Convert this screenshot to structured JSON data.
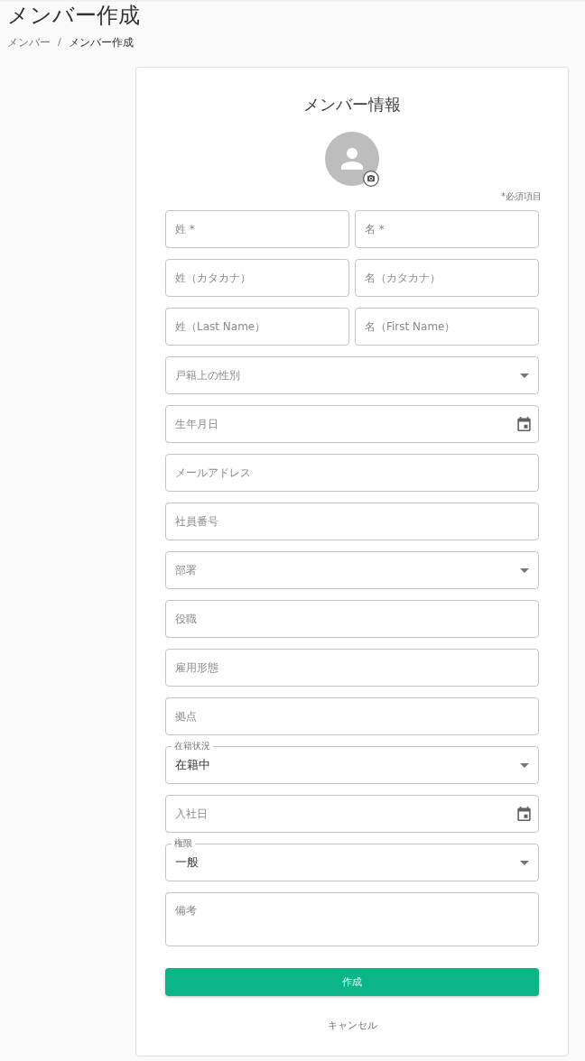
{
  "page": {
    "title": "メンバー作成",
    "breadcrumb": [
      {
        "label": "メンバー",
        "current": false
      },
      {
        "label": "メンバー作成",
        "current": true
      }
    ],
    "breadcrumb_separator": "/"
  },
  "card": {
    "title": "メンバー情報",
    "required_note": "*必須項目",
    "rows": [
      {
        "fields": [
          {
            "kind": "text",
            "label": "姓 *"
          },
          {
            "kind": "text",
            "label": "名 *"
          }
        ]
      },
      {
        "fields": [
          {
            "kind": "text",
            "label": "姓（カタカナ）"
          },
          {
            "kind": "text",
            "label": "名（カタカナ）"
          }
        ]
      },
      {
        "fields": [
          {
            "kind": "text",
            "label": "姓（Last Name）"
          },
          {
            "kind": "text",
            "label": "名（First Name）"
          }
        ]
      },
      {
        "fields": [
          {
            "kind": "select",
            "label": "戸籍上の性別"
          }
        ]
      },
      {
        "fields": [
          {
            "kind": "date",
            "label": "生年月日"
          }
        ]
      },
      {
        "fields": [
          {
            "kind": "text",
            "label": "メールアドレス"
          }
        ]
      },
      {
        "fields": [
          {
            "kind": "text",
            "label": "社員番号"
          }
        ]
      },
      {
        "fields": [
          {
            "kind": "select",
            "label": "部署"
          }
        ]
      },
      {
        "fields": [
          {
            "kind": "text",
            "label": "役職"
          }
        ]
      },
      {
        "fields": [
          {
            "kind": "text",
            "label": "雇用形態"
          }
        ]
      },
      {
        "fields": [
          {
            "kind": "text",
            "label": "拠点"
          }
        ]
      },
      {
        "fields": [
          {
            "kind": "select",
            "label": "在籍状況",
            "value": "在籍中"
          }
        ]
      },
      {
        "fields": [
          {
            "kind": "date",
            "label": "入社日"
          }
        ]
      },
      {
        "fields": [
          {
            "kind": "select",
            "label": "権限",
            "value": "一般"
          }
        ]
      },
      {
        "fields": [
          {
            "kind": "textarea",
            "label": "備考"
          }
        ]
      }
    ],
    "submit_button": "作成",
    "cancel_button": "キャンセル"
  }
}
